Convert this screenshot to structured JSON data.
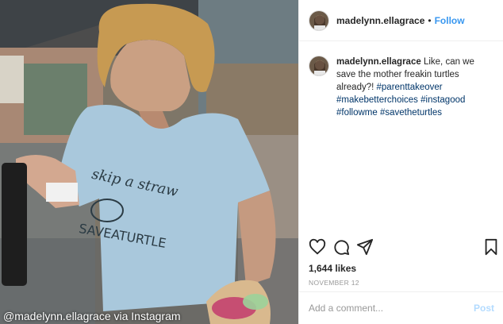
{
  "photo": {
    "credit": "@madelynn.ellagrace via Instagram",
    "shirt_line1": "skip a straw",
    "shirt_line2": "SAVEATURTLE"
  },
  "header": {
    "username": "madelynn.ellagrace",
    "separator": "•",
    "follow_label": "Follow"
  },
  "caption": {
    "username": "madelynn.ellagrace",
    "text": "Like, can we save the mother freakin turtles already?!",
    "hashtags": [
      "#parenttakeover",
      "#makebetterchoices",
      "#instagood",
      "#followme",
      "#savetheturtles"
    ]
  },
  "actions": {
    "icons": [
      "heart-icon",
      "comment-icon",
      "share-icon",
      "bookmark-icon"
    ]
  },
  "likes": "1,644 likes",
  "date": "NOVEMBER 12",
  "comment_box": {
    "placeholder": "Add a comment...",
    "post_label": "Post"
  },
  "colors": {
    "link": "#3897f0",
    "hashtag": "#003569",
    "shirt": "#a9c8dc"
  }
}
